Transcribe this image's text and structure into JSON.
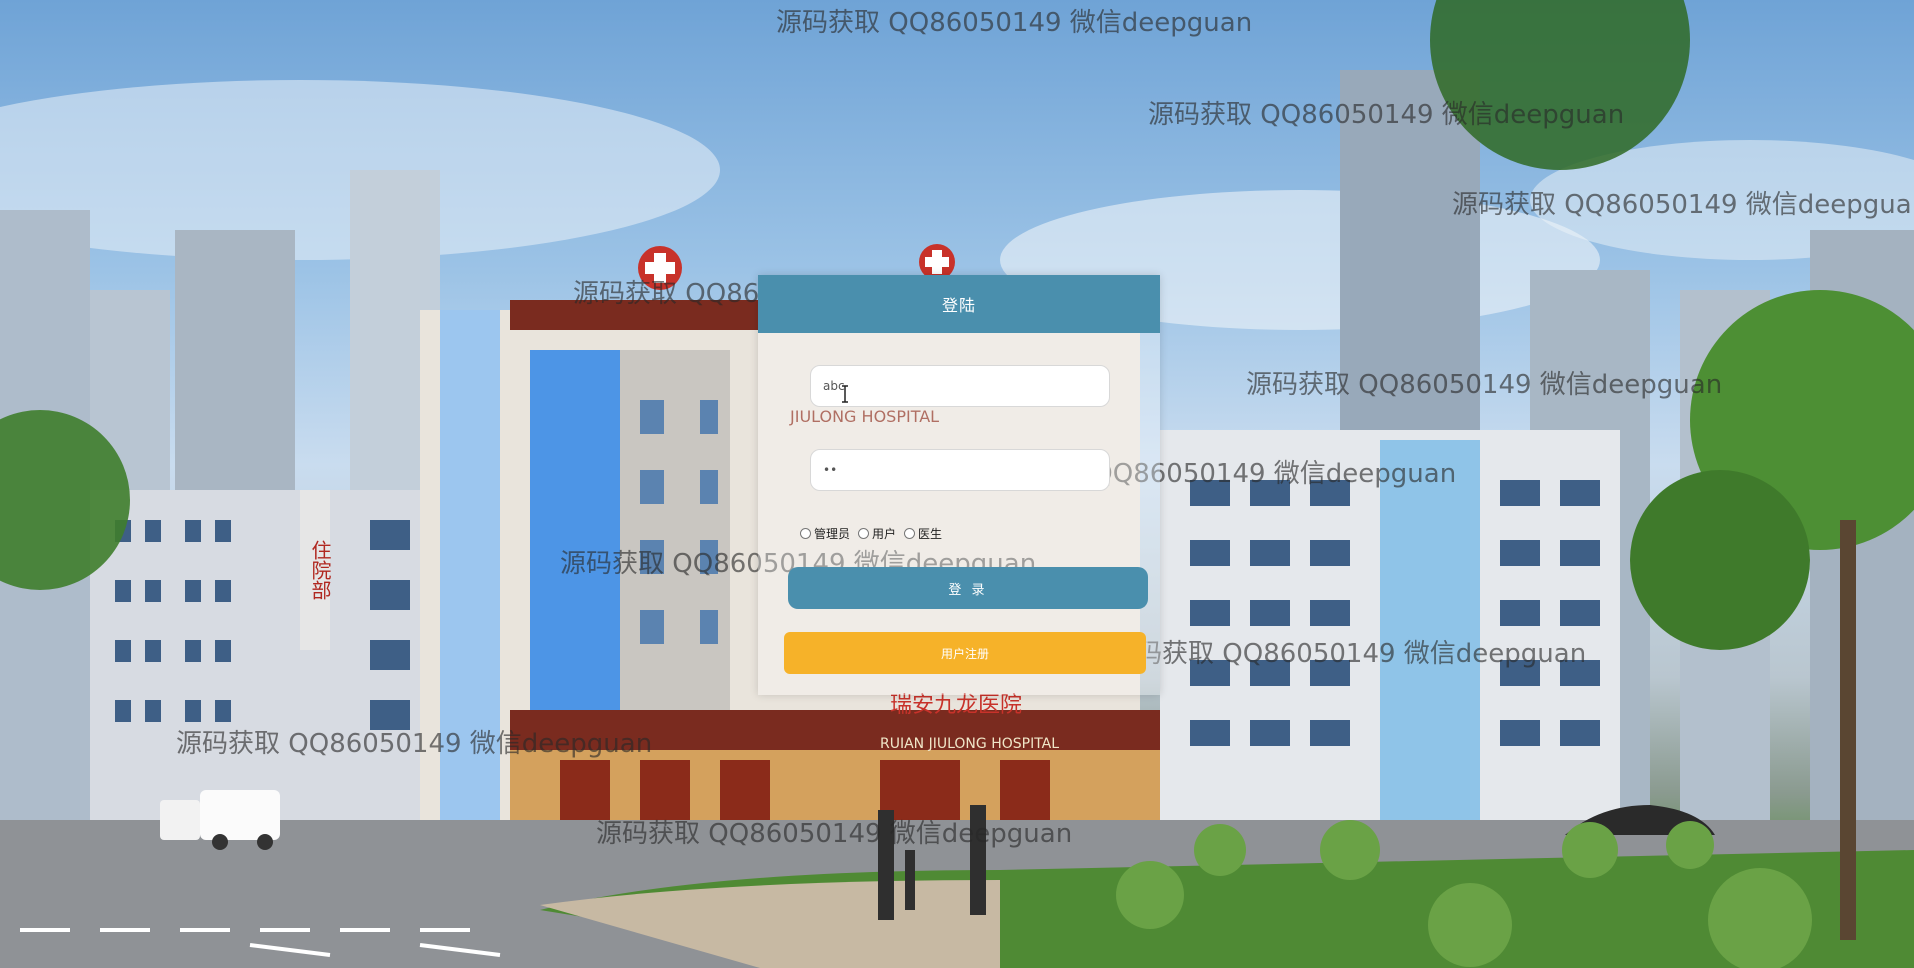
{
  "login": {
    "title": "登陆",
    "username_value": "abc",
    "password_value": "••",
    "roles": [
      "管理员",
      "用户",
      "医生"
    ],
    "login_button": "登 录",
    "register_button": "用户注册"
  },
  "watermarks": [
    "源码获取 QQ86050149 微信deepguan",
    "源码获取 QQ86050149 微信deepguan",
    "源码获取 QQ86050149 微信deepguan",
    "源码获取 QQ86050149 微信deepguan",
    "源码获取 QQ86050149 微信deepguan",
    "源码获取 QQ86050149 微信deepguan",
    "源码获取 QQ86050149 微信deepguan",
    "源码获取 QQ86050149 微信deepguan",
    "源码获取 QQ86050149 微信deepguan",
    "源码获取 QQ86050149 微信deepguan"
  ],
  "background": {
    "hospital_sign": "RUIAN JIULONG HOSPITAL",
    "hospital_sign_upper": "JIULONG HOSPITAL",
    "hospital_name_cn": "瑞安九龙医院",
    "wing_sign": "住院部"
  },
  "colors": {
    "header": "#4a8fad",
    "login_button": "#4a8fad",
    "register_button": "#f6b229"
  }
}
